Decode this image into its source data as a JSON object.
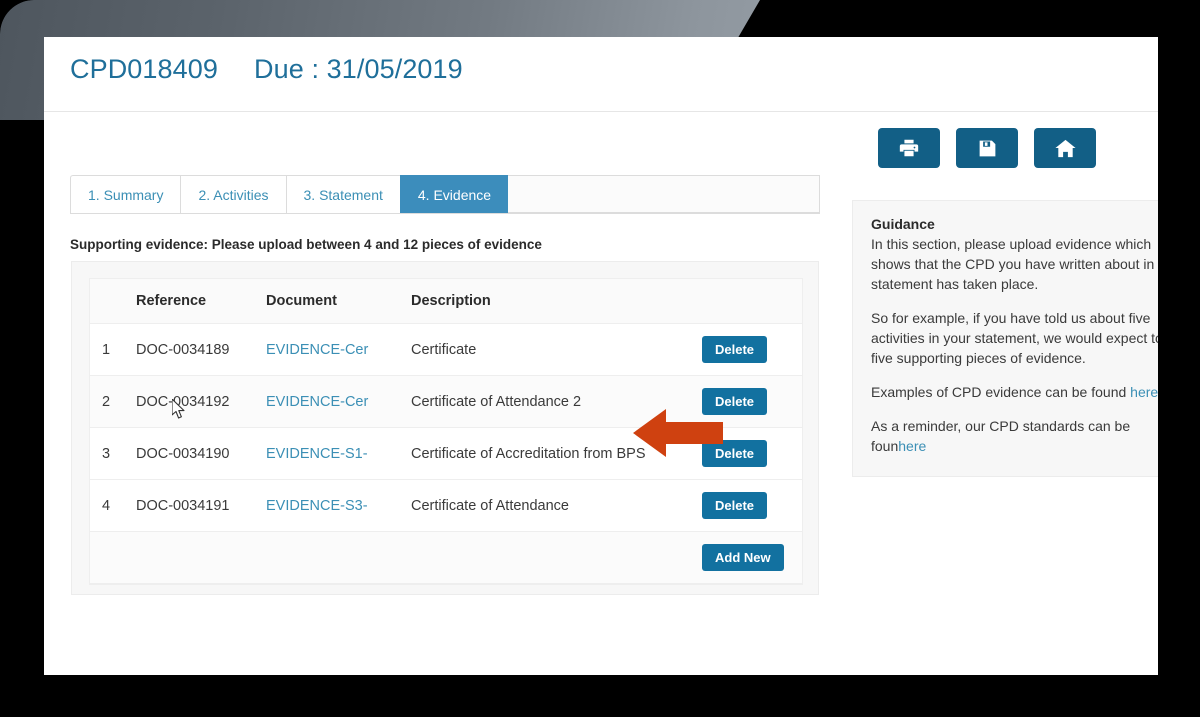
{
  "header": {
    "reference": "CPD018409",
    "due": "Due : 31/05/2019"
  },
  "toolbar": {
    "print_label": "print-icon",
    "save_label": "save-icon",
    "home_label": "home-icon",
    "button_color": "#125f86"
  },
  "tabs": [
    {
      "label": "1. Summary",
      "active": false
    },
    {
      "label": "2. Activities",
      "active": false
    },
    {
      "label": "3. Statement",
      "active": false
    },
    {
      "label": "4. Evidence",
      "active": true
    }
  ],
  "subtitle": "Supporting evidence: Please upload between 4 and 12 pieces of evidence",
  "table": {
    "columns": [
      "",
      "Reference",
      "Document",
      "Description",
      ""
    ],
    "rows": [
      {
        "index": "1",
        "reference": "DOC-0034189",
        "document": "EVIDENCE-Cer",
        "description": "Certificate",
        "action": "Delete"
      },
      {
        "index": "2",
        "reference": "DOC-0034192",
        "document": "EVIDENCE-Cer",
        "description": "Certificate of Attendance 2",
        "action": "Delete"
      },
      {
        "index": "3",
        "reference": "DOC-0034190",
        "document": "EVIDENCE-S1-",
        "description": "Certificate of Accreditation from BPS",
        "action": "Delete"
      },
      {
        "index": "4",
        "reference": "DOC-0034191",
        "document": "EVIDENCE-S3-",
        "description": "Certificate of Attendance",
        "action": "Delete"
      }
    ],
    "add_new_label": "Add New"
  },
  "guidance": {
    "title": "Guidance",
    "para1_line1": "In this section, please upload evidence which",
    "para1_line2": "shows that the CPD you have written about in",
    "para1_line3": "statement has taken place.",
    "para2_line1": "So for example, if you have told us about five",
    "para2_line2": "activities in your statement, we would expect to",
    "para2_line3": "five supporting pieces of evidence.",
    "para3_text": "Examples of CPD evidence can be found ",
    "para3_link": "here",
    "para4_text": "As a reminder, our CPD standards can be foun",
    "para4_link": "here"
  },
  "annotation": {
    "arrow_color": "#cf4110",
    "arrow_direction": "left"
  },
  "theme": {
    "accent_blue": "#3c8dbc",
    "link_blue": "#3b8fb5",
    "button_blue": "#1271a0",
    "bezel_black": "#000000"
  }
}
